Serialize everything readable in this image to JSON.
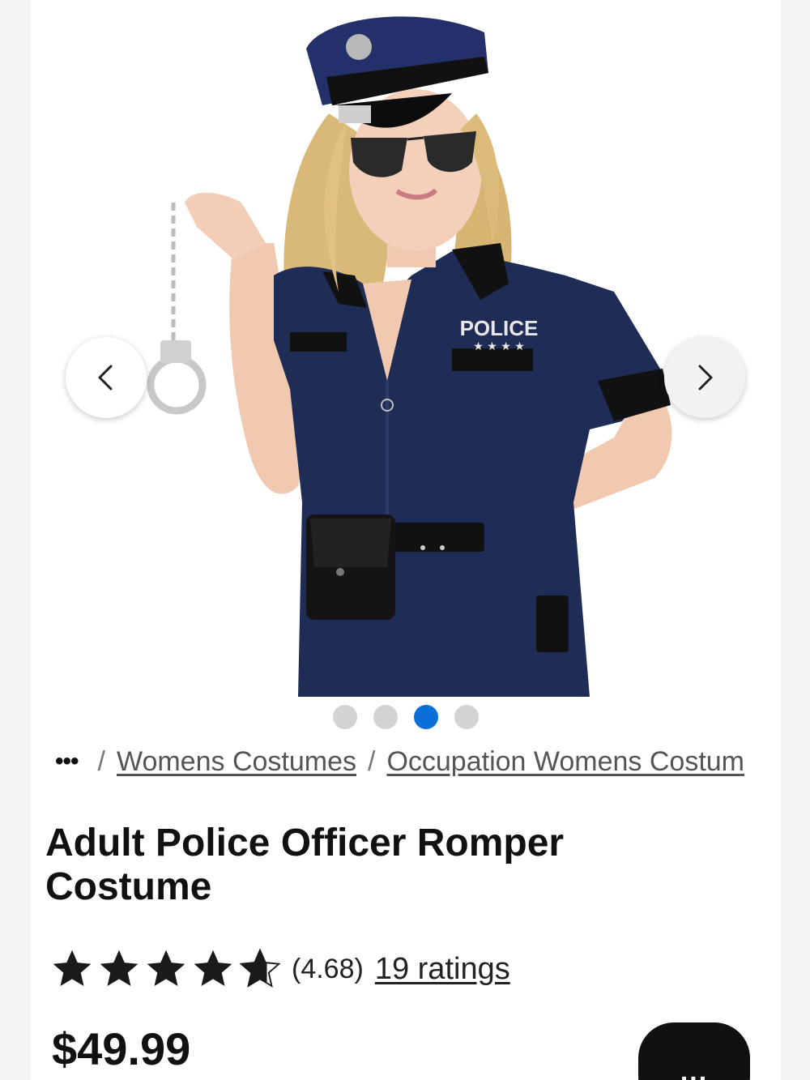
{
  "gallery": {
    "image_alt": "Adult Police Officer Romper Costume",
    "badge_text": "POLICE",
    "prev_icon": "chevron-left-icon",
    "next_icon": "chevron-right-icon",
    "dot_count": 4,
    "active_dot": 3
  },
  "breadcrumb": {
    "more": "•••",
    "separator": "/",
    "items": [
      "Womens Costumes",
      "Occupation Womens Costum"
    ]
  },
  "product": {
    "title": "Adult Police Officer Romper Costume",
    "rating_value": 4.68,
    "rating_display": "(4.68)",
    "ratings_link": "19 ratings",
    "price": "$49.99"
  },
  "chat": {
    "icon": "chat-bubble-icon",
    "dots": "..."
  },
  "colors": {
    "accent_dot": "#0a6fd8",
    "uniform_navy": "#1f2c56",
    "text": "#111111"
  }
}
